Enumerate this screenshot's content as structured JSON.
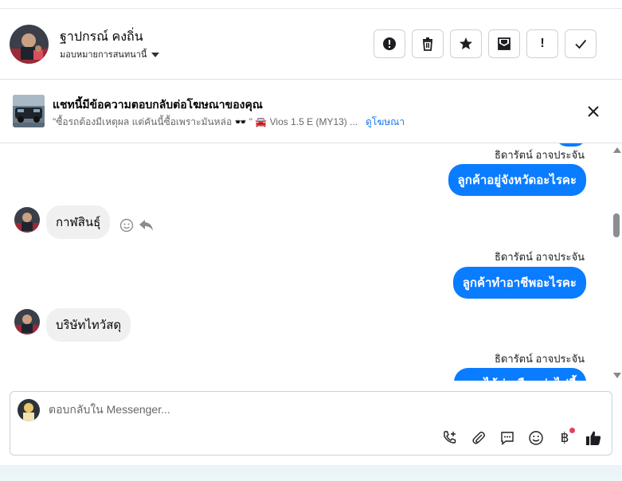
{
  "header": {
    "contact_name": "ฐาปกรณ์ คงถิ่น",
    "assign_label": "มอบหมายการสนทนานี้",
    "actions": [
      {
        "name": "mark-spam-button",
        "icon": "alert-circle-icon"
      },
      {
        "name": "delete-button",
        "icon": "trash-icon"
      },
      {
        "name": "star-button",
        "icon": "star-icon"
      },
      {
        "name": "mark-unread-button",
        "icon": "envelope-icon"
      },
      {
        "name": "follow-up-button",
        "icon": "exclamation-icon",
        "glyph": "!"
      },
      {
        "name": "mark-done-button",
        "icon": "check-icon"
      }
    ]
  },
  "ad_banner": {
    "title": "แชทนี้มีข้อความตอบกลับต่อโฆษณาของคุณ",
    "ad_text": "\"ซื้อรถต้องมีเหตุผล แต่คันนี้ซื้อเพราะมันหล่อ 🕶️ \" 🚘 Vios 1.5 E (MY13) ...",
    "link_label": "ดูโฆษณา"
  },
  "messages": [
    {
      "direction": "out",
      "sender": "ธิดารัตน์ อาจประจัน",
      "text": "ลูกค้าอยู่จังหวัดอะไรคะ"
    },
    {
      "direction": "in",
      "text": "กาฬสินธุ์"
    },
    {
      "direction": "out",
      "sender": "ธิดารัตน์ อาจประจัน",
      "text": "ลูกค้าทำอาชีพอะไรคะ"
    },
    {
      "direction": "in",
      "text": "บริษัทไทวัสดุ"
    },
    {
      "direction": "out",
      "sender": "ธิดารัตน์ อาจประจัน",
      "text": "รายได้ต่อเดือนต่อไปนี้"
    }
  ],
  "composer": {
    "placeholder": "ตอบกลับใน Messenger...",
    "baht_symbol": "฿"
  },
  "colors": {
    "accent": "#0a7cff",
    "link": "#1877f2",
    "notification": "#e4405f"
  }
}
